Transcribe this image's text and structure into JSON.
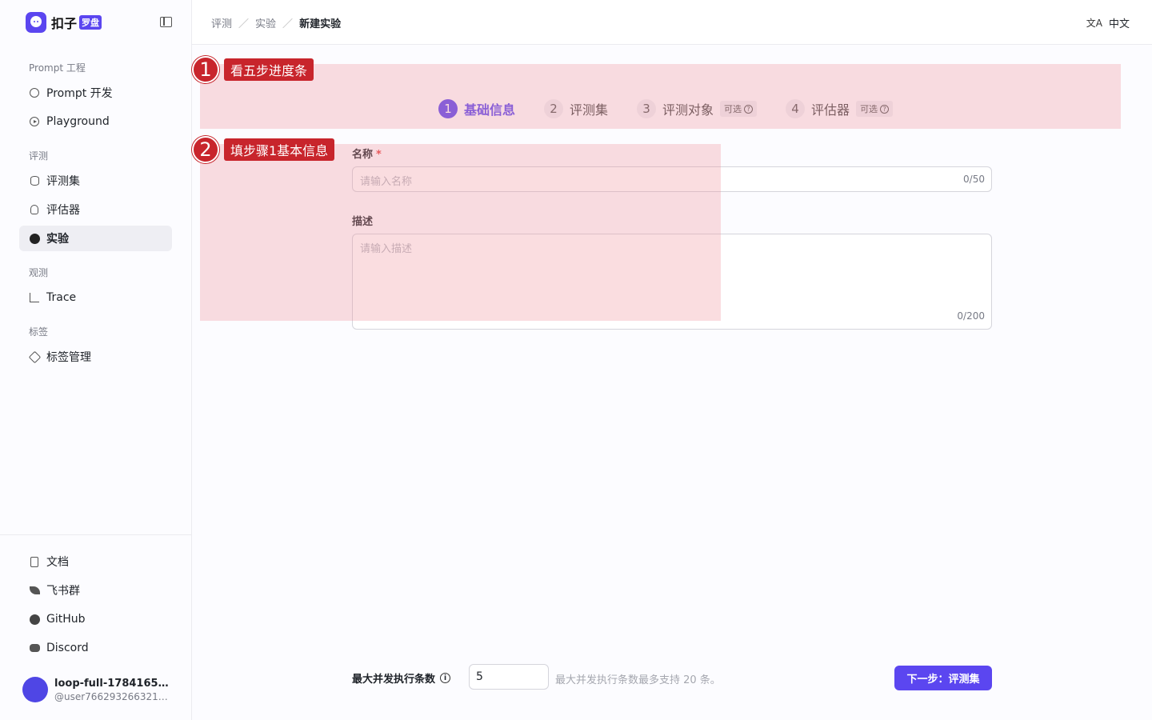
{
  "brand": {
    "name": "扣子",
    "badge": "罗盘"
  },
  "sidebar": {
    "groups": [
      {
        "title": "Prompt 工程",
        "items": [
          {
            "label": "Prompt 开发",
            "icon": "prompt-icon"
          },
          {
            "label": "Playground",
            "icon": "play-icon"
          }
        ]
      },
      {
        "title": "评测",
        "items": [
          {
            "label": "评测集",
            "icon": "database-icon"
          },
          {
            "label": "评估器",
            "icon": "bulb-icon"
          },
          {
            "label": "实验",
            "icon": "gauge-icon",
            "active": true
          }
        ]
      },
      {
        "title": "观测",
        "items": [
          {
            "label": "Trace",
            "icon": "trace-icon"
          }
        ]
      },
      {
        "title": "标签",
        "items": [
          {
            "label": "标签管理",
            "icon": "tag-icon"
          }
        ]
      }
    ],
    "footer": [
      {
        "label": "文档",
        "icon": "doc-icon"
      },
      {
        "label": "飞书群",
        "icon": "feishu-icon"
      },
      {
        "label": "GitHub",
        "icon": "github-icon"
      },
      {
        "label": "Discord",
        "icon": "discord-icon"
      }
    ],
    "user": {
      "name": "loop-full-178416554...",
      "handle": "@user76629326632121..."
    }
  },
  "header": {
    "breadcrumb": [
      "评测",
      "实验",
      "新建实验"
    ],
    "language": "中文",
    "language_icon": "文A"
  },
  "steps": [
    {
      "num": "1",
      "label": "基础信息",
      "active": true
    },
    {
      "num": "2",
      "label": "评测集"
    },
    {
      "num": "3",
      "label": "评测对象",
      "optional": "可选"
    },
    {
      "num": "4",
      "label": "评估器",
      "optional": "可选"
    }
  ],
  "form": {
    "name_label": "名称",
    "required_mark": "*",
    "name_placeholder": "请输入名称",
    "name_counter": "0/50",
    "desc_label": "描述",
    "desc_placeholder": "请输入描述",
    "desc_counter": "0/200"
  },
  "footer_bar": {
    "concurrency_label": "最大并发执行条数",
    "concurrency_value": "5",
    "concurrency_hint": "最大并发执行条数最多支持 20 条。",
    "next_button": "下一步：评测集"
  },
  "annotations": [
    {
      "num": "1",
      "text": "看五步进度条"
    },
    {
      "num": "2",
      "text": "填步骤1基本信息"
    }
  ],
  "colors": {
    "accent": "#5b46f0",
    "annotation": "#c8252c"
  }
}
